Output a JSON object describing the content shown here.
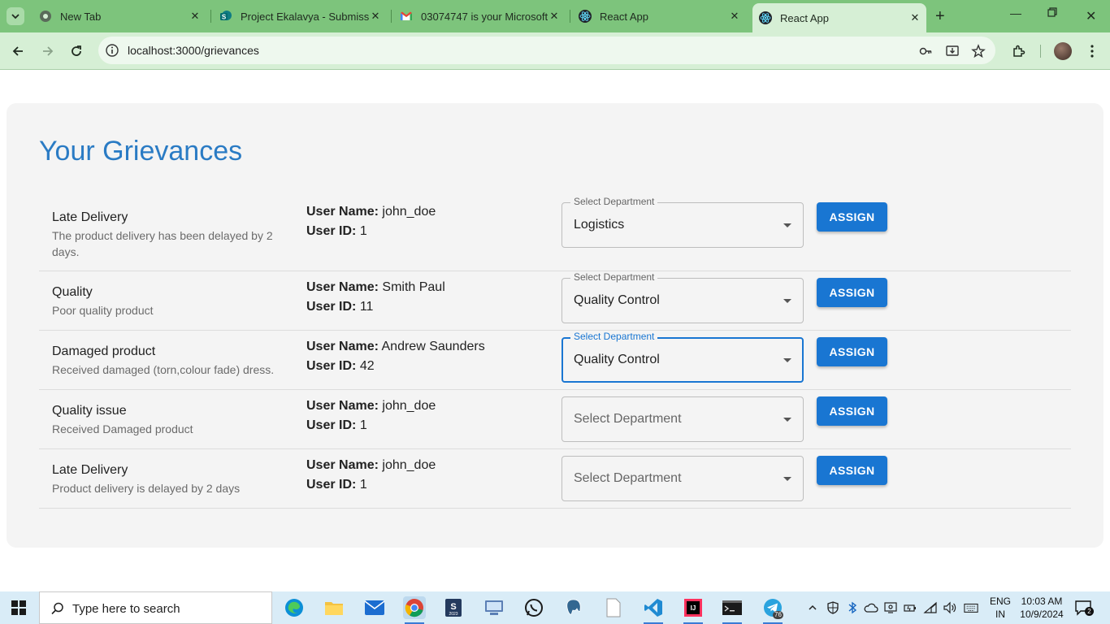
{
  "browser": {
    "tabs": [
      {
        "title": "New Tab",
        "active": false
      },
      {
        "title": "Project Ekalavya - Submissio",
        "active": false
      },
      {
        "title": "03074747 is your Microsoft",
        "active": false
      },
      {
        "title": "React App",
        "active": false
      },
      {
        "title": "React App",
        "active": true
      }
    ],
    "url": "localhost:3000/grievances"
  },
  "page": {
    "title": "Your Grievances",
    "user_name_label": "User Name:",
    "user_id_label": "User ID:",
    "select_label": "Select Department",
    "select_placeholder": "Select Department",
    "assign_label": "ASSIGN",
    "grievances": [
      {
        "title": "Late Delivery",
        "description": "The product delivery has been delayed by 2 days.",
        "user_name": "john_doe",
        "user_id": "1",
        "department": "Logistics",
        "focused": false
      },
      {
        "title": "Quality",
        "description": "Poor quality product",
        "user_name": "Smith Paul",
        "user_id": "11",
        "department": "Quality Control",
        "focused": false
      },
      {
        "title": "Damaged product",
        "description": "Received damaged (torn,colour fade) dress.",
        "user_name": "Andrew Saunders",
        "user_id": "42",
        "department": "Quality Control",
        "focused": true
      },
      {
        "title": "Quality issue",
        "description": "Received Damaged product",
        "user_name": "john_doe",
        "user_id": "1",
        "department": "",
        "focused": false
      },
      {
        "title": "Late Delivery",
        "description": "Product delivery is delayed by 2 days",
        "user_name": "john_doe",
        "user_id": "1",
        "department": "",
        "focused": false
      }
    ]
  },
  "taskbar": {
    "search_placeholder": "Type here to search",
    "lang_top": "ENG",
    "lang_bottom": "IN",
    "time": "10:03 AM",
    "date": "10/9/2024",
    "notification_count": "2",
    "telegram_badge": "76"
  },
  "colors": {
    "accent": "#1976d2",
    "title": "#2a7bc4",
    "tab_strip": "#7dc47c",
    "toolbar": "#d6efd5"
  }
}
